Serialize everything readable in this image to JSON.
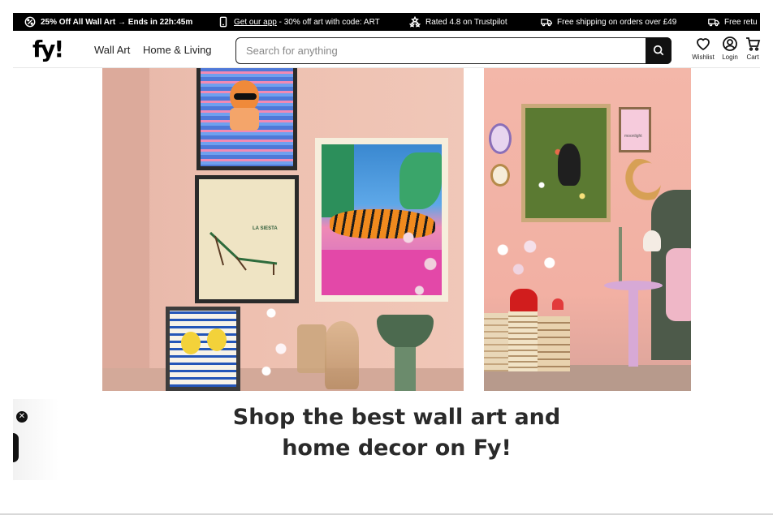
{
  "promo_bar": {
    "discount": "25% Off All Wall Art → Ends in 22h:45m",
    "app_link": "Get our app",
    "app_text": " - 30% off art with code: ART",
    "rating": "Rated 4.8 on Trustpilot",
    "shipping": "Free shipping on orders over £49",
    "returns": "Free retu"
  },
  "header": {
    "logo": "fy!",
    "nav": [
      "Wall Art",
      "Home & Living"
    ],
    "search_placeholder": "Search for anything",
    "actions": {
      "wishlist": "Wishlist",
      "login": "Login",
      "cart": "Cart"
    }
  },
  "hero": {
    "art_labels": {
      "siesta": "LA SIESTA",
      "moon_print": "moonlight"
    }
  },
  "headline": {
    "line1": "Shop the best wall art and",
    "line2": "home decor on Fy!"
  },
  "widget": {
    "close": "✕"
  },
  "colors": {
    "promo_bg": "#000000",
    "hero_left_wall": "#eec0b0",
    "hero_right_wall": "#f2b0a3",
    "headline": "#2a2a2a"
  }
}
